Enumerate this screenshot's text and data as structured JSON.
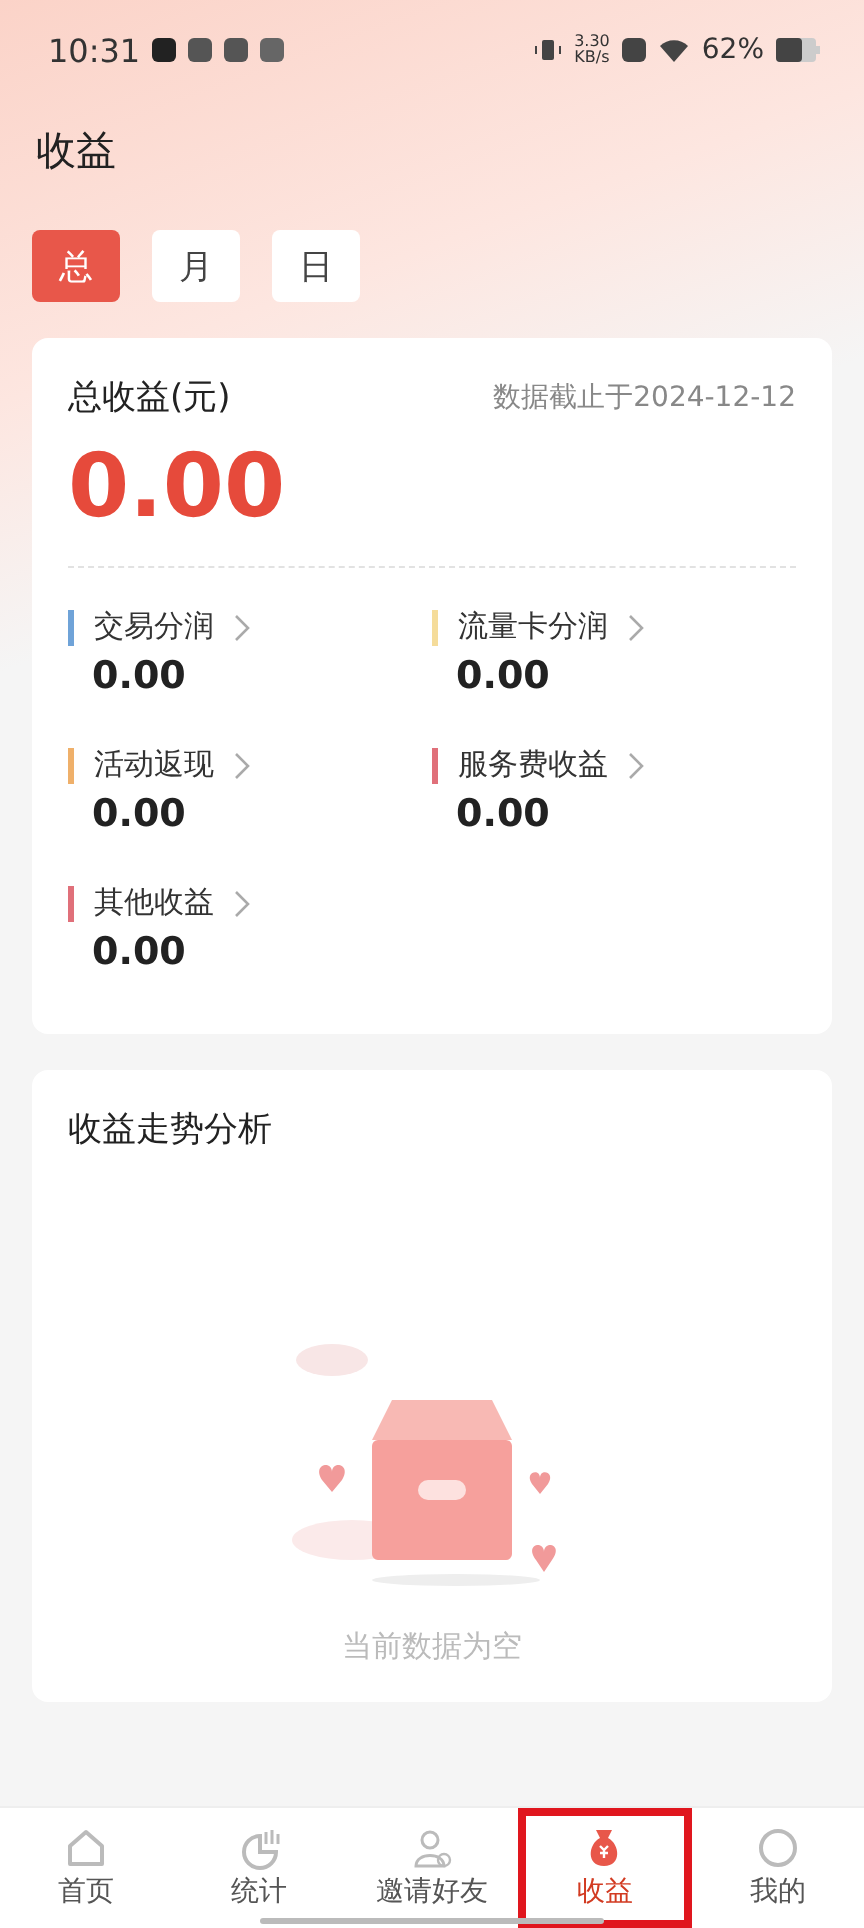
{
  "status_bar": {
    "time": "10:31",
    "speed_value": "3.30",
    "speed_unit": "KB/s",
    "battery": "62%"
  },
  "header": {
    "title": "收益"
  },
  "period_tabs": [
    {
      "label": "总",
      "selected": true
    },
    {
      "label": "月",
      "selected": false
    },
    {
      "label": "日",
      "selected": false
    }
  ],
  "summary": {
    "title": "总收益(元)",
    "as_of": "数据截止于2024-12-12",
    "total": "0.00",
    "items": [
      {
        "label": "交易分润",
        "value": "0.00",
        "color": "#6fa3d8"
      },
      {
        "label": "流量卡分润",
        "value": "0.00",
        "color": "#f5dc9a"
      },
      {
        "label": "活动返现",
        "value": "0.00",
        "color": "#efb06a"
      },
      {
        "label": "服务费收益",
        "value": "0.00",
        "color": "#e0707a"
      },
      {
        "label": "其他收益",
        "value": "0.00",
        "color": "#e0707a"
      }
    ]
  },
  "trend": {
    "title": "收益走势分析",
    "empty_text": "当前数据为空"
  },
  "bottom_nav": [
    {
      "label": "首页",
      "kind": "home",
      "selected": false,
      "highlighted": false
    },
    {
      "label": "统计",
      "kind": "stats",
      "selected": false,
      "highlighted": false
    },
    {
      "label": "邀请好友",
      "kind": "invite",
      "selected": false,
      "highlighted": false
    },
    {
      "label": "收益",
      "kind": "income",
      "selected": true,
      "highlighted": true
    },
    {
      "label": "我的",
      "kind": "me",
      "selected": false,
      "highlighted": false
    }
  ]
}
